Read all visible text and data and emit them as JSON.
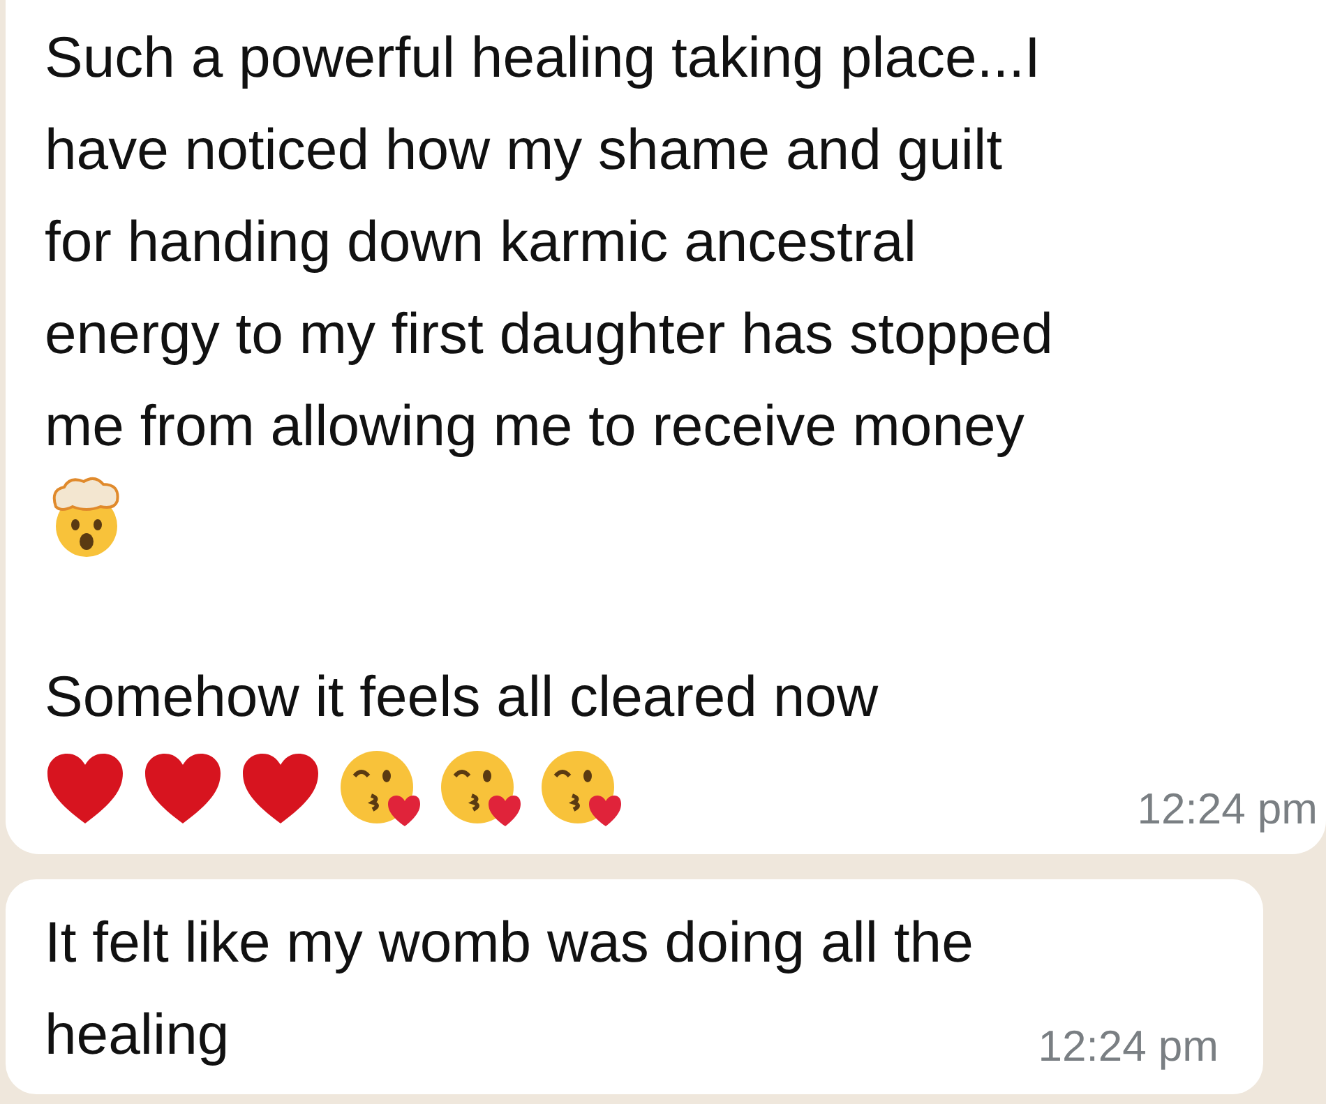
{
  "messages": [
    {
      "blocks": [
        {
          "kind": "text",
          "text": "Such a powerful healing taking place...I\nhave noticed how my shame and guilt\nfor handing down karmic ancestral\nenergy to my first daughter has stopped\nme from allowing me to receive money"
        },
        {
          "kind": "emoji_row",
          "emojis": [
            {
              "kind": "exploding_head"
            }
          ]
        },
        {
          "kind": "text",
          "text": "Somehow it feels all cleared now"
        },
        {
          "kind": "emoji_row",
          "emojis": [
            {
              "kind": "heart"
            },
            {
              "kind": "heart"
            },
            {
              "kind": "heart"
            },
            {
              "kind": "kiss"
            },
            {
              "kind": "kiss"
            },
            {
              "kind": "kiss"
            }
          ]
        }
      ],
      "time": "12:24 pm"
    },
    {
      "blocks": [
        {
          "kind": "text",
          "text": "It felt like my womb was doing all the\nhealing"
        }
      ],
      "time": "12:24 pm"
    }
  ]
}
